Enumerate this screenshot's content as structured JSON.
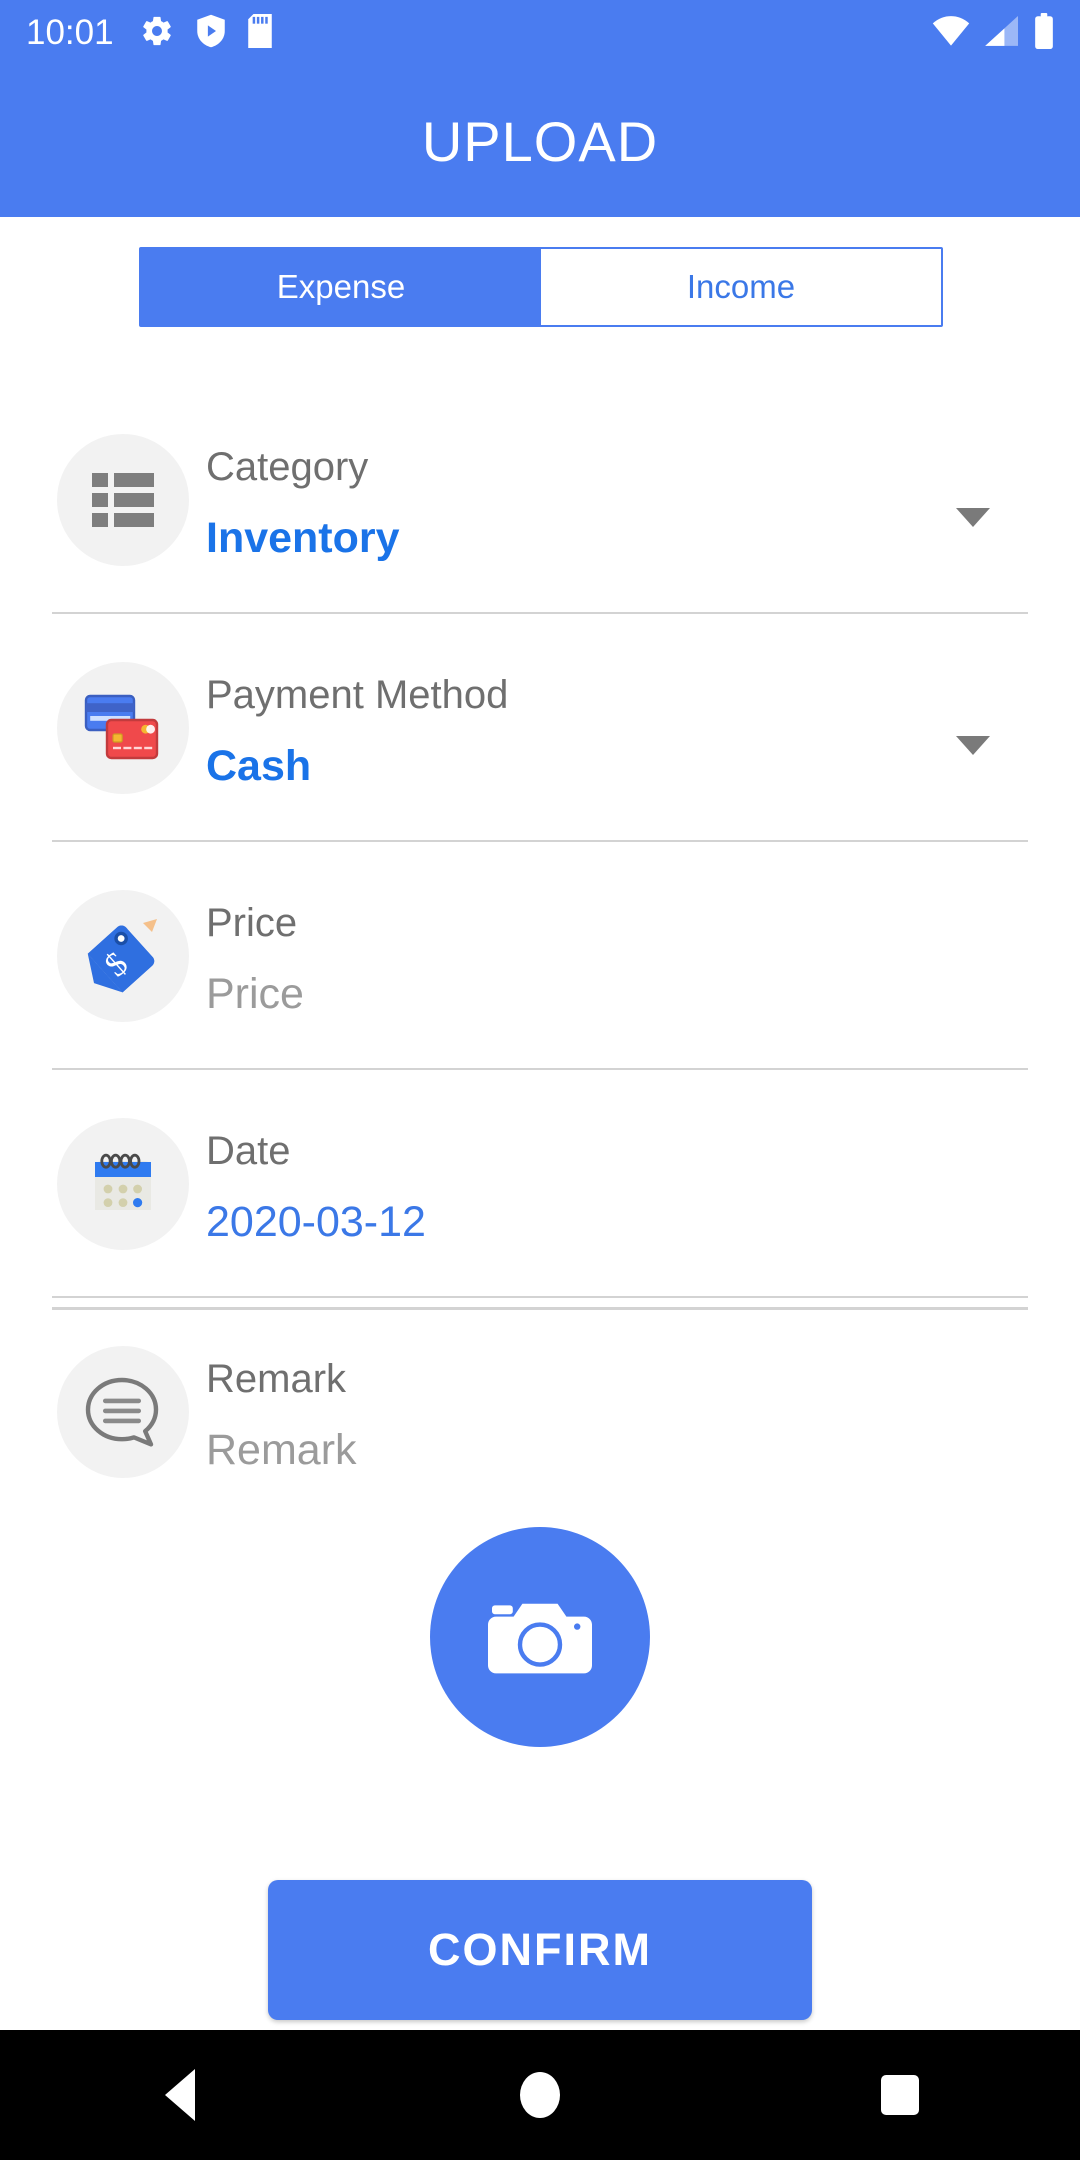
{
  "status_bar": {
    "time": "10:01",
    "left_icons": [
      "settings-gear-icon",
      "shield-play-icon",
      "sd-card-icon"
    ],
    "right_icons": [
      "wifi-icon",
      "cellular-signal-icon",
      "battery-icon"
    ]
  },
  "app_bar": {
    "title": "UPLOAD"
  },
  "tabs": [
    {
      "label": "Expense",
      "active": true
    },
    {
      "label": "Income",
      "active": false
    }
  ],
  "form": {
    "rows": [
      {
        "icon": "list-icon",
        "label": "Category",
        "value": "Inventory",
        "value_state": "filled",
        "has_caret": true
      },
      {
        "icon": "credit-cards-icon",
        "label": "Payment Method",
        "value": "Cash",
        "value_state": "filled",
        "has_caret": true
      },
      {
        "icon": "price-tag-icon",
        "label": "Price",
        "value": "Price",
        "value_state": "placeholder",
        "has_caret": false
      },
      {
        "icon": "calendar-icon",
        "label": "Date",
        "value": "2020-03-12",
        "value_state": "date",
        "has_caret": false
      },
      {
        "icon": "comment-icon",
        "label": "Remark",
        "value": "Remark",
        "value_state": "placeholder",
        "has_caret": false
      }
    ]
  },
  "camera_button": {
    "icon": "camera-icon"
  },
  "confirm_button": {
    "label": "CONFIRM"
  },
  "nav_bar": {
    "back": "back-triangle-icon",
    "home": "home-circle-icon",
    "recents": "recents-square-icon"
  },
  "colors": {
    "accent": "#4a7cf0",
    "link": "#1a73e8",
    "label": "#6f6f6f",
    "placeholder": "#9b9b9b",
    "divider": "#d3d3d3",
    "icon_bg": "#f2f2f2"
  }
}
